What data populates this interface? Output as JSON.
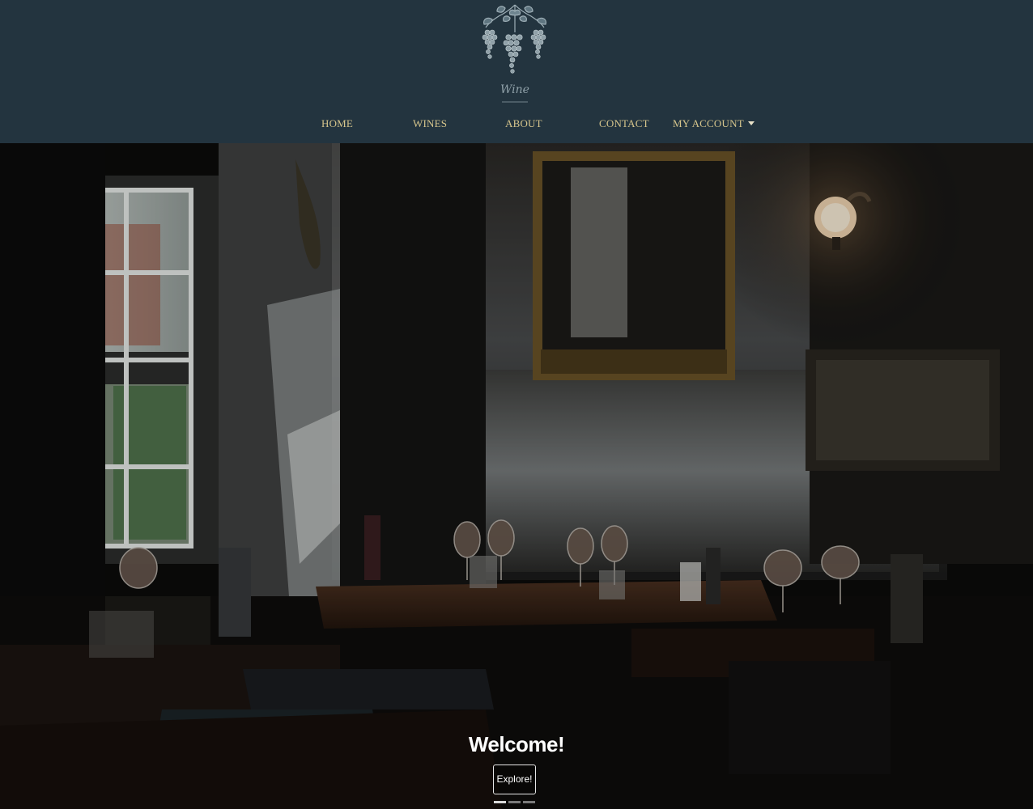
{
  "logo": {
    "text": "Wine",
    "icon": "grape-vine-icon"
  },
  "nav": {
    "items": [
      {
        "label": "HOME"
      },
      {
        "label": "WINES"
      },
      {
        "label": "ABOUT"
      },
      {
        "label": "CONTACT"
      },
      {
        "label": "MY ACCOUNT",
        "dropdown": true
      }
    ]
  },
  "hero": {
    "welcome": "Welcome!",
    "button_label": "Explore!",
    "carousel_slide_count": 3,
    "carousel_active_index": 0
  },
  "colors": {
    "header_bg": "#23343f",
    "nav_text": "#d6c58c"
  }
}
